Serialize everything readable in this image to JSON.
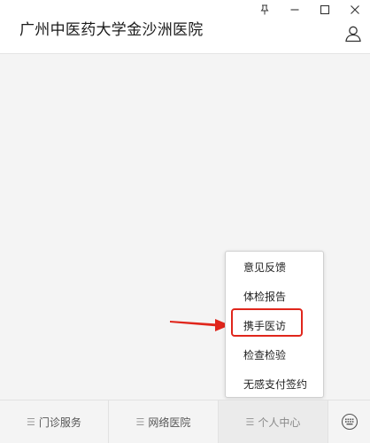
{
  "window": {
    "title": "广州中医药大学金沙洲医院",
    "controls": [
      "pin",
      "minimize",
      "maximize",
      "close"
    ]
  },
  "header": {
    "user_icon": "user-icon"
  },
  "popup_menu": {
    "items": [
      {
        "label": "意见反馈"
      },
      {
        "label": "体检报告"
      },
      {
        "label": "携手医访",
        "highlighted": true
      },
      {
        "label": "检查检验"
      },
      {
        "label": "无感支付签约"
      }
    ]
  },
  "bottom_tabs": [
    {
      "label": "门诊服务",
      "icon": "menu-icon"
    },
    {
      "label": "网络医院",
      "icon": "menu-icon"
    },
    {
      "label": "个人中心",
      "icon": "menu-icon",
      "active": true
    }
  ],
  "keyboard_icon": "keyboard-icon",
  "colors": {
    "highlight": "#e0261c",
    "background": "#f4f4f4",
    "header_bg": "#ffffff"
  }
}
